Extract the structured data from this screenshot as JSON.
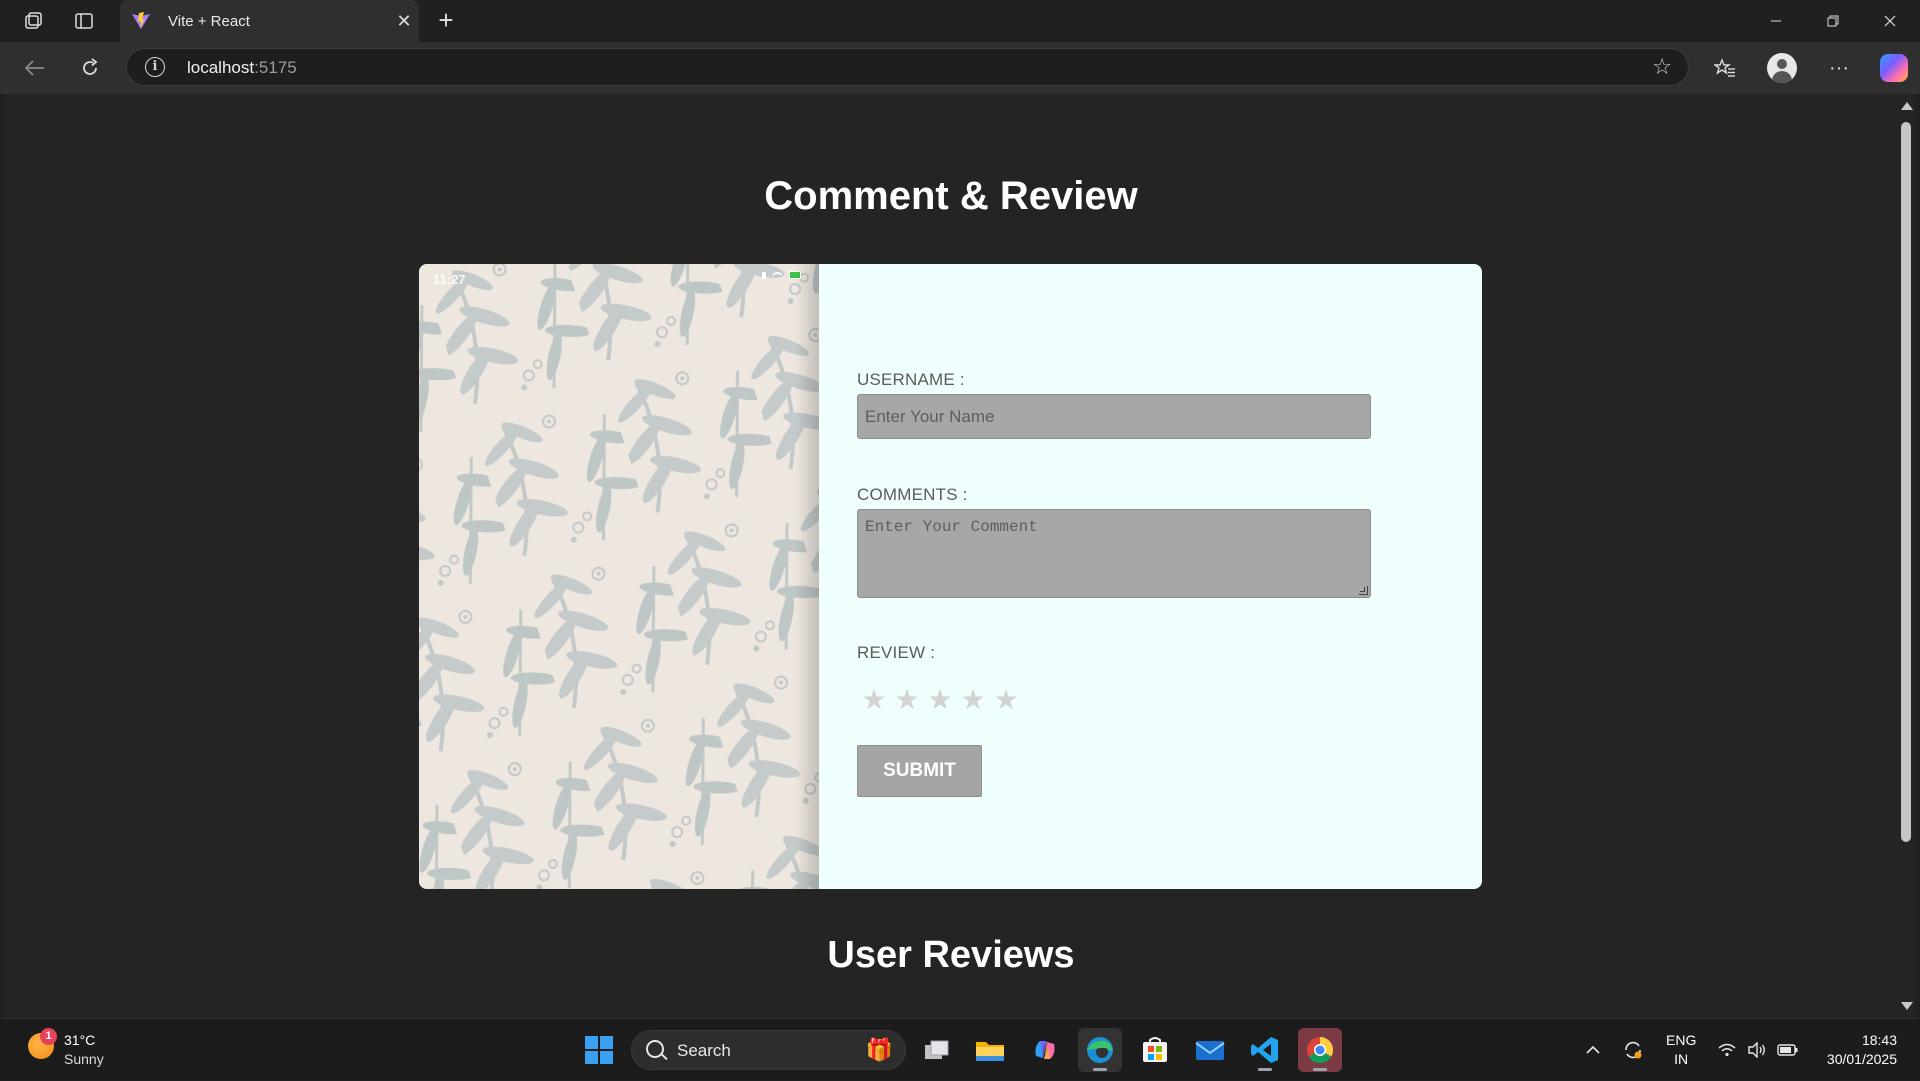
{
  "browser": {
    "tab_title": "Vite + React",
    "url_host": "localhost",
    "url_port": ":5175"
  },
  "page": {
    "title": "Comment & Review",
    "image_status_time": "11:27",
    "form": {
      "username_label": "USERNAME :",
      "username_placeholder": "Enter Your Name",
      "comments_label": "COMMENTS :",
      "comments_placeholder": "Enter Your Comment",
      "review_label": "REVIEW :",
      "stars": [
        "★",
        "★",
        "★",
        "★",
        "★"
      ],
      "submit_label": "SUBMIT"
    },
    "reviews_title": "User Reviews"
  },
  "taskbar": {
    "weather_badge": "1",
    "weather_temp": "31°C",
    "weather_desc": "Sunny",
    "search_label": "Search",
    "lang_line1": "ENG",
    "lang_line2": "IN",
    "time": "18:43",
    "date": "30/01/2025"
  }
}
